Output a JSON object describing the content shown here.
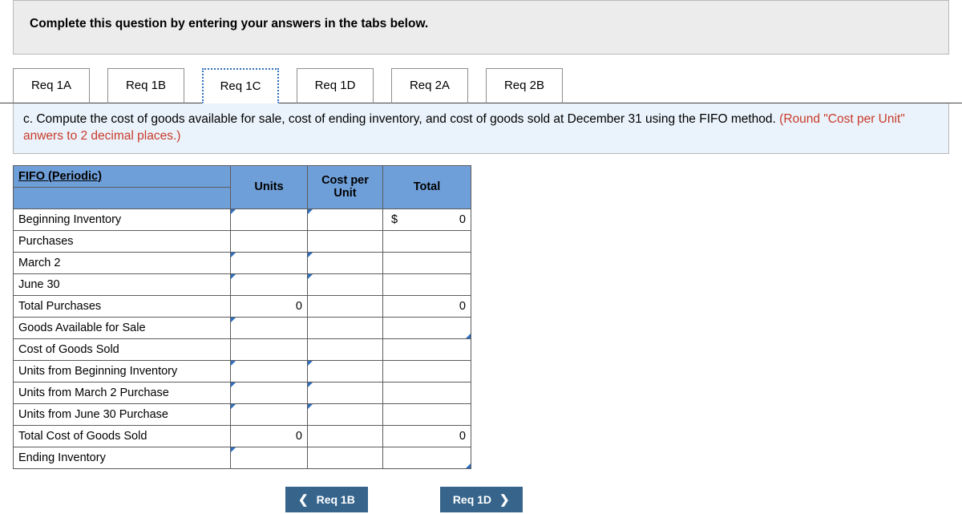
{
  "instruction": "Complete this question by entering your answers in the tabs below.",
  "tabs": [
    {
      "label": "Req 1A",
      "active": false
    },
    {
      "label": "Req 1B",
      "active": false
    },
    {
      "label": "Req 1C",
      "active": true
    },
    {
      "label": "Req 1D",
      "active": false
    },
    {
      "label": "Req 2A",
      "active": false
    },
    {
      "label": "Req 2B",
      "active": false
    }
  ],
  "question": {
    "pre": "c. Compute the cost of goods available for sale, cost of ending inventory, and cost of goods sold at December 31 using the FIFO method. ",
    "red": "(Round \"Cost per Unit\" anwers to 2 decimal places.)"
  },
  "table": {
    "title": "FIFO (Periodic)",
    "headers": {
      "units": "Units",
      "cpu": "Cost per Unit",
      "total": "Total"
    },
    "currency": "$",
    "rows": [
      {
        "label": "Beginning Inventory",
        "indent": 0,
        "units": "",
        "cpu": "",
        "total": "0",
        "dollar": true,
        "marks": {
          "u": true,
          "c": true,
          "t": false
        }
      },
      {
        "label": "Purchases",
        "indent": 0,
        "units": null,
        "cpu": null,
        "total": null,
        "marks": {}
      },
      {
        "label": "March 2",
        "indent": 1,
        "units": "",
        "cpu": "",
        "total": "",
        "marks": {
          "u": true,
          "c": true,
          "t": false
        }
      },
      {
        "label": "June 30",
        "indent": 1,
        "units": "",
        "cpu": "",
        "total": "",
        "marks": {
          "u": true,
          "c": true,
          "t": false
        }
      },
      {
        "label": "Total Purchases",
        "indent": 2,
        "units": "0",
        "cpu": null,
        "total": "0",
        "marks": {}
      },
      {
        "label": "Goods Available for Sale",
        "indent": 0,
        "units": "",
        "cpu": null,
        "total": "",
        "marks": {
          "u": true,
          "c": false,
          "t": true
        }
      },
      {
        "label": "Cost of Goods Sold",
        "indent": 0,
        "units": null,
        "cpu": null,
        "total": null,
        "marks": {}
      },
      {
        "label": "Units from Beginning Inventory",
        "indent": 1,
        "units": "",
        "cpu": "",
        "total": "",
        "marks": {
          "u": true,
          "c": true,
          "t": false
        }
      },
      {
        "label": "Units from March 2 Purchase",
        "indent": 1,
        "units": "",
        "cpu": "",
        "total": "",
        "marks": {
          "u": true,
          "c": true,
          "t": false
        }
      },
      {
        "label": "Units from June 30 Purchase",
        "indent": 1,
        "units": "",
        "cpu": "",
        "total": "",
        "marks": {
          "u": true,
          "c": true,
          "t": false
        }
      },
      {
        "label": "Total Cost of Goods Sold",
        "indent": 3,
        "units": "0",
        "cpu": null,
        "total": "0",
        "marks": {}
      },
      {
        "label": "Ending Inventory",
        "indent": 0,
        "units": "",
        "cpu": null,
        "total": "",
        "marks": {
          "u": true,
          "c": false,
          "t": true
        }
      }
    ]
  },
  "nav": {
    "prev": "Req 1B",
    "next": "Req 1D"
  }
}
